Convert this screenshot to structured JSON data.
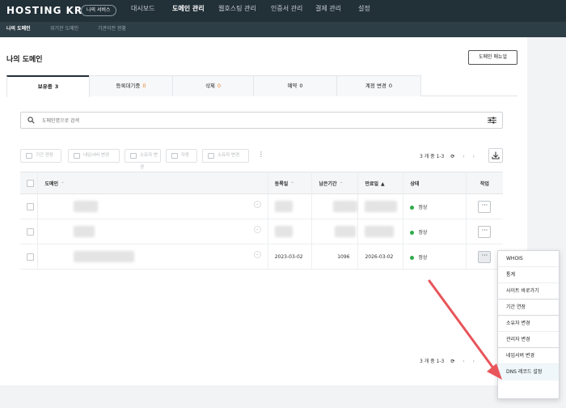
{
  "brand": {
    "logo": "HOSTING KR",
    "service_badge": "나의 서비스"
  },
  "gnb": [
    {
      "label": "대시보드",
      "active": false
    },
    {
      "label": "도메인 관리",
      "active": true
    },
    {
      "label": "웹호스팅 관리",
      "active": false
    },
    {
      "label": "인증서 관리",
      "active": false
    },
    {
      "label": "결제 관리",
      "active": false
    },
    {
      "label": "설정",
      "active": false
    }
  ],
  "subnav": [
    {
      "label": "나의 도메인",
      "active": true
    },
    {
      "label": "위기관 도메인",
      "active": false
    },
    {
      "label": "기관이전 현황",
      "active": false
    }
  ],
  "page": {
    "title": "나의 도메인",
    "manual_button": "도메인 매뉴얼"
  },
  "tabs": [
    {
      "label": "보유중",
      "count": "3",
      "active": true
    },
    {
      "label": "등록대기중",
      "count": "0",
      "active": false
    },
    {
      "label": "삭제",
      "count": "0",
      "active": false
    },
    {
      "label": "예약",
      "count": "0",
      "active": false
    },
    {
      "label": "계정 변경",
      "count": "0",
      "active": false
    }
  ],
  "search": {
    "placeholder": "도메인명으로 검색"
  },
  "toolbar": {
    "buttons": [
      "기간 연장",
      "네임서버 변경",
      "소유자 변경",
      "자동",
      "소유자 변경"
    ],
    "pager_text": "3 개 중 1-3"
  },
  "table": {
    "columns": [
      "도메인",
      "등록일",
      "남은기간",
      "만료일",
      "상태",
      "작업"
    ],
    "rows": [
      {
        "domain": "",
        "registered": "",
        "remaining": "",
        "expires": "",
        "status": "정상"
      },
      {
        "domain": "",
        "registered": "",
        "remaining": "",
        "expires": "",
        "status": "정상"
      },
      {
        "domain": "",
        "registered": "2023-03-02",
        "remaining": "1096",
        "expires": "2026-03-02",
        "status": "정상"
      }
    ]
  },
  "bottom_pager": {
    "text": "3 개 중 1-3"
  },
  "action_menu": {
    "items": [
      "WHOIS",
      "통계",
      "사이트 바로가기",
      "기간 연장",
      "소유자 변경",
      "관리자 변경",
      "네임서버 변경",
      "DNS 레코드 설정"
    ]
  },
  "colors": {
    "topbar": "#223038",
    "accent_count": "#e67e22",
    "status_ok": "#2eaa4a",
    "arrow": "#e8555a"
  }
}
